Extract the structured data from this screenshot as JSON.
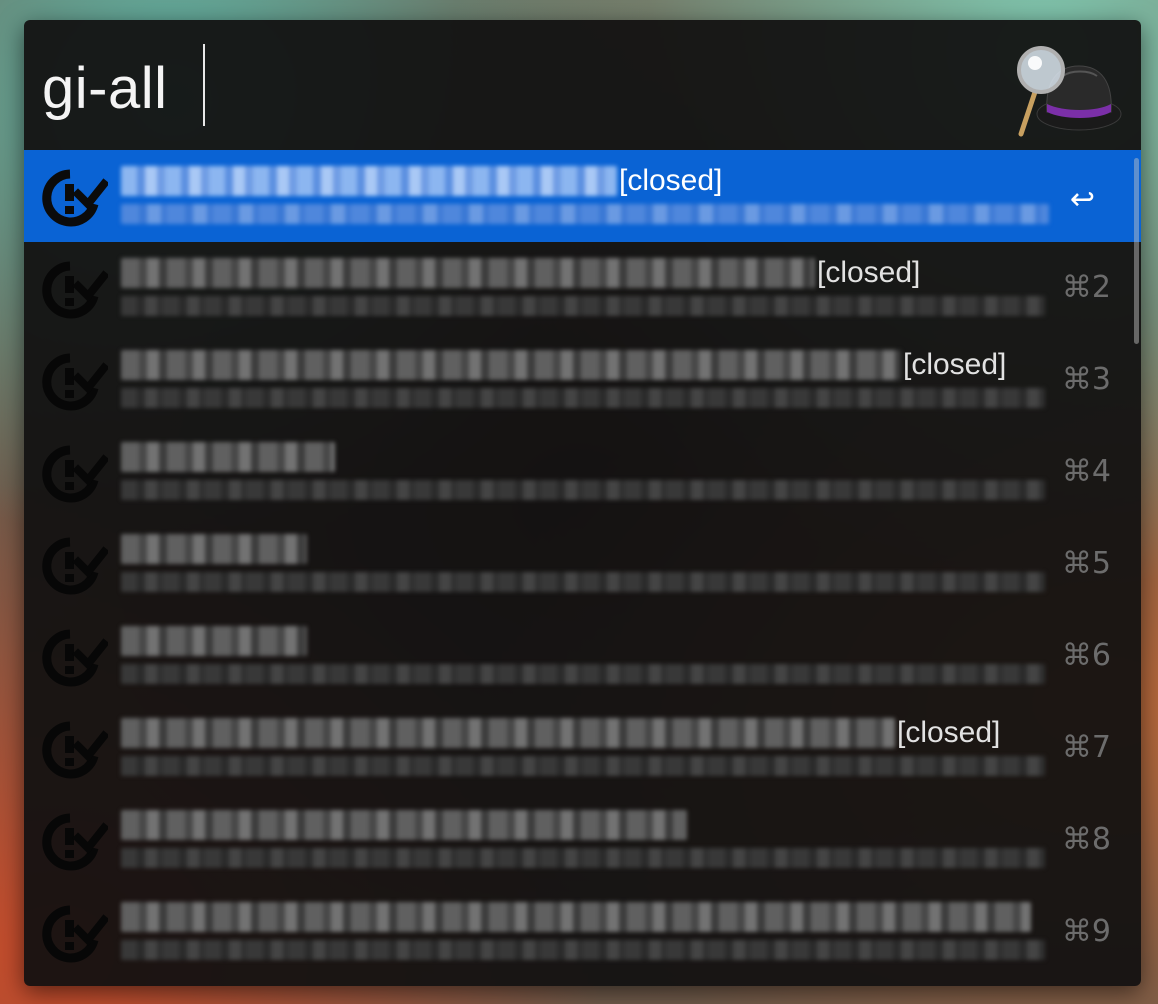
{
  "search": {
    "query": "gi-all"
  },
  "app": {
    "logo_icon": "alfred-hat-magnifier-icon"
  },
  "results": [
    {
      "status": "[closed]",
      "shortcut": "↩",
      "selected": true
    },
    {
      "status": "[closed]",
      "shortcut": "⌘2",
      "selected": false
    },
    {
      "status": "[closed]",
      "shortcut": "⌘3",
      "selected": false
    },
    {
      "status": "",
      "shortcut": "⌘4",
      "selected": false
    },
    {
      "status": "",
      "shortcut": "⌘5",
      "selected": false
    },
    {
      "status": "",
      "shortcut": "⌘6",
      "selected": false
    },
    {
      "status": "[closed]",
      "shortcut": "⌘7",
      "selected": false
    },
    {
      "status": "",
      "shortcut": "⌘8",
      "selected": false
    },
    {
      "status": "",
      "shortcut": "⌘9",
      "selected": false
    }
  ],
  "colors": {
    "selection": "#0a63d4",
    "background": "#121111",
    "shortcut": "#6c6c6c"
  }
}
